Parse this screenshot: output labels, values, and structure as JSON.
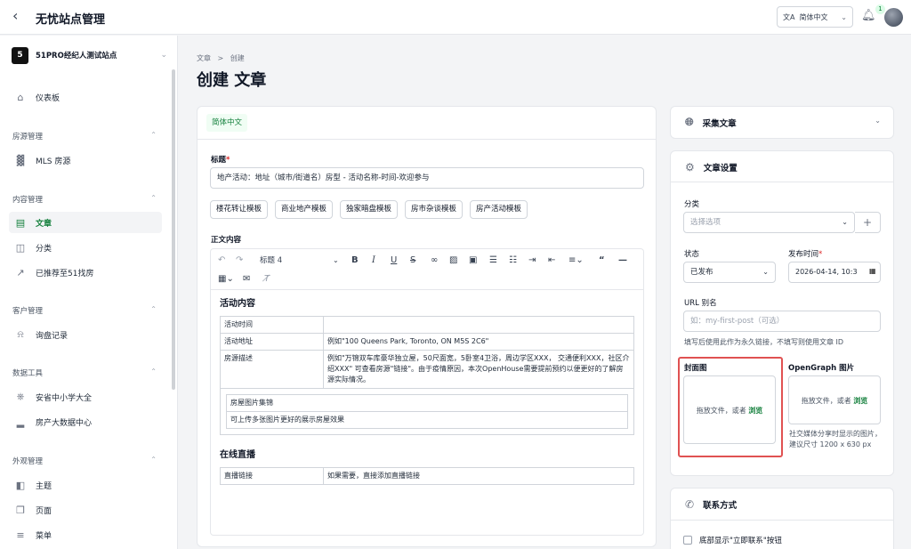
{
  "header": {
    "back_icon": "chevron-left-icon",
    "title": "无忧站点管理",
    "language": "简体中文",
    "notification_count": "1"
  },
  "sidebar": {
    "site_badge": "5",
    "site_name": "51PRO经纪人测试站点",
    "dashboard": "仪表板",
    "groups": {
      "listings": "房源管理",
      "content": "内容管理",
      "customers": "客户管理",
      "data": "数据工具",
      "appearance": "外观管理"
    },
    "items": {
      "mls": "MLS 房源",
      "articles": "文章",
      "categories": "分类",
      "recommended": "已推荐至51找房",
      "inquiries": "询盘记录",
      "schools": "安省中小学大全",
      "bigdata": "房产大数据中心",
      "themes": "主题",
      "pages": "页面",
      "menus": "菜单"
    }
  },
  "breadcrumb": {
    "parent": "文章",
    "separator": ">",
    "current": "创建"
  },
  "page_title": "创建 文章",
  "form": {
    "language_tab": "简体中文",
    "title_label": "标题",
    "title_value": "地产活动：地址（城市/街道名）房型 - 活动名称-时间-欢迎参与",
    "templates": [
      "楼花转让模板",
      "商业地产模板",
      "独家暗盘模板",
      "房市杂谈模板",
      "房产活动模板"
    ],
    "body_label": "正文内容",
    "toolbar": {
      "heading": "标题 4"
    },
    "content": {
      "heading1": "活动内容",
      "rows": [
        {
          "key": "活动时间",
          "value": ""
        },
        {
          "key": "活动地址",
          "value": "例如\"100 Queens Park, Toronto, ON M5S 2C6\""
        },
        {
          "key": "房源描述",
          "value": "例如\"万锦双车库豪华独立屋，50尺面宽，5卧室4卫浴，周边学区XXX， 交通便利XXX，社区介绍XXX\" 可查看房源\"链接\"。由于疫情原因，本次OpenHouse需要提前预约以便更好的了解房源实际情况。"
        }
      ],
      "gallery_title": "房屋图片集锦",
      "gallery_text": "可上传多张图片更好的展示房屋效果",
      "heading2": "在线直播",
      "live_key": "直播链接",
      "live_value": "如果需要，直接添加直播链接"
    }
  },
  "right": {
    "collect_title": "采集文章",
    "settings_title": "文章设置",
    "category_label": "分类",
    "category_placeholder": "选择选项",
    "add_symbol": "+",
    "status_label": "状态",
    "status_value": "已发布",
    "publish_label": "发布时间",
    "publish_value": "2026-04-14, 10:3",
    "slug_label": "URL 别名",
    "slug_placeholder": "如：my-first-post（可选）",
    "slug_help": "填写后使用此作为永久链接，不填写则使用文章 ID",
    "cover_label": "封面图",
    "drop_text": "拖放文件，或者",
    "browse": "浏览",
    "og_label": "OpenGraph 图片",
    "og_help": "社交媒体分享时显示的图片，建议尺寸 1200 x 630 px",
    "contact_title": "联系方式",
    "contact_checkbox": "底部显示\"立即联系\"按钮"
  }
}
